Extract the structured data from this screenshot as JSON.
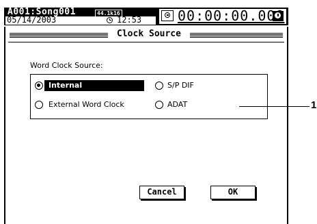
{
  "status": {
    "song": "A001:Song001",
    "rate_badge": "44.1k16",
    "date": "05/14/2003",
    "time": "12:53",
    "counter": "00:00:00.000",
    "icons": [
      "clock-icon",
      "locate-icon",
      "alarm-icon"
    ]
  },
  "dialog": {
    "title": "Clock Source",
    "group_label": "Word Clock Source:",
    "options": [
      {
        "label": "Internal",
        "selected": true
      },
      {
        "label": "S/P DIF",
        "selected": false
      },
      {
        "label": "External Word Clock",
        "selected": false
      },
      {
        "label": "ADAT",
        "selected": false
      }
    ],
    "cancel_label": "Cancel",
    "ok_label": "OK"
  },
  "callout": {
    "number": "1"
  }
}
